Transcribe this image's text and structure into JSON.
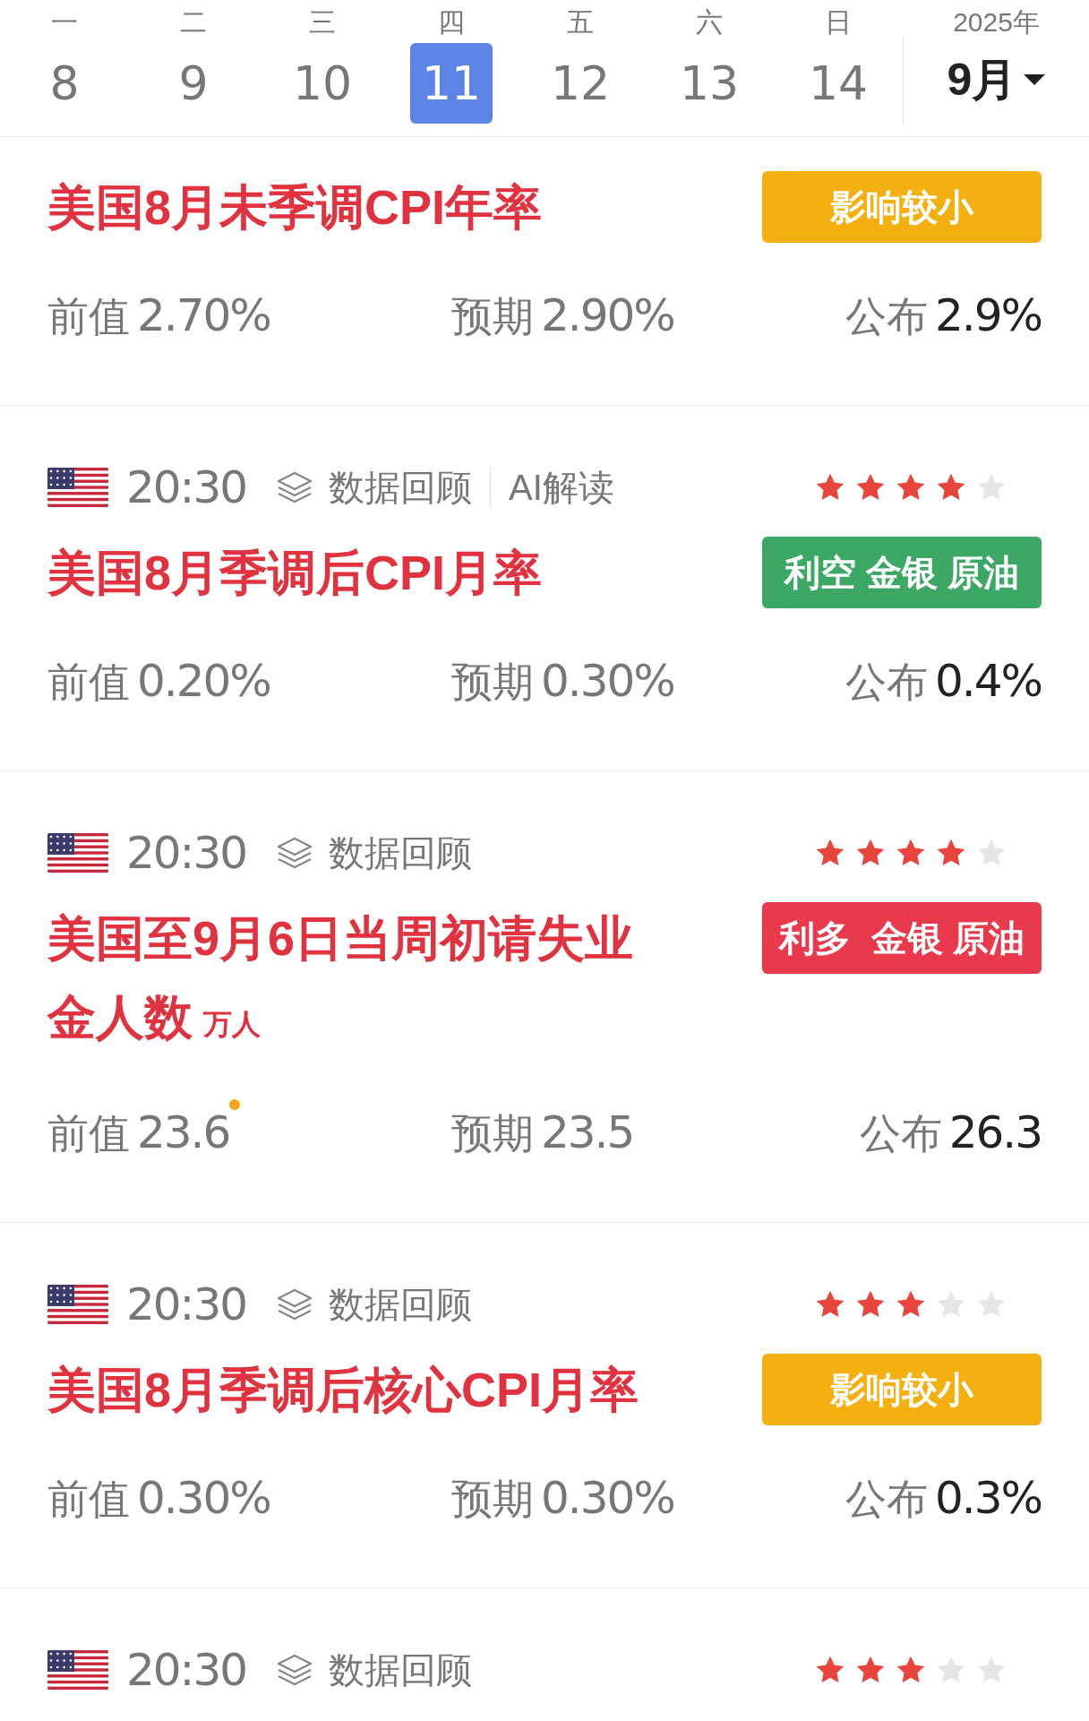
{
  "calendar": {
    "days": [
      {
        "weekday": "一",
        "date": "8",
        "selected": false
      },
      {
        "weekday": "二",
        "date": "9",
        "selected": false
      },
      {
        "weekday": "三",
        "date": "10",
        "selected": false
      },
      {
        "weekday": "四",
        "date": "11",
        "selected": true
      },
      {
        "weekday": "五",
        "date": "12",
        "selected": false
      },
      {
        "weekday": "六",
        "date": "13",
        "selected": false
      },
      {
        "weekday": "日",
        "date": "14",
        "selected": false
      }
    ],
    "year": "2025年",
    "month": "9月"
  },
  "events": [
    {
      "title": "美国8月未季调CPI年率",
      "badge": {
        "text": "影响较小",
        "kind": "low_impact"
      },
      "previous": {
        "label": "前值",
        "value": "2.70%",
        "dot": false
      },
      "forecast": {
        "label": "预期",
        "value": "2.90%"
      },
      "actual": {
        "label": "公布",
        "value": "2.9%"
      }
    },
    {
      "time": "20:30",
      "links": [
        "数据回顾",
        "AI解读"
      ],
      "stars": 4,
      "title": "美国8月季调后CPI月率",
      "badge": {
        "text": "利空 金银 原油",
        "kind": "bearish"
      },
      "previous": {
        "label": "前值",
        "value": "0.20%",
        "dot": false
      },
      "forecast": {
        "label": "预期",
        "value": "0.30%"
      },
      "actual": {
        "label": "公布",
        "value": "0.4%"
      }
    },
    {
      "time": "20:30",
      "links": [
        "数据回顾"
      ],
      "stars": 4,
      "title": "美国至9月6日当周初请失业金人数",
      "unit": "万人",
      "badge": {
        "text": "利多  金银 原油",
        "kind": "bullish"
      },
      "previous": {
        "label": "前值",
        "value": "23.6",
        "dot": true
      },
      "forecast": {
        "label": "预期",
        "value": "23.5"
      },
      "actual": {
        "label": "公布",
        "value": "26.3"
      }
    },
    {
      "time": "20:30",
      "links": [
        "数据回顾"
      ],
      "stars": 3,
      "title": "美国8月季调后核心CPI月率",
      "badge": {
        "text": "影响较小",
        "kind": "low_impact"
      },
      "previous": {
        "label": "前值",
        "value": "0.30%",
        "dot": false
      },
      "forecast": {
        "label": "预期",
        "value": "0.30%"
      },
      "actual": {
        "label": "公布",
        "value": "0.3%"
      }
    },
    {
      "time": "20:30",
      "links": [
        "数据回顾"
      ],
      "stars": 3
    }
  ]
}
